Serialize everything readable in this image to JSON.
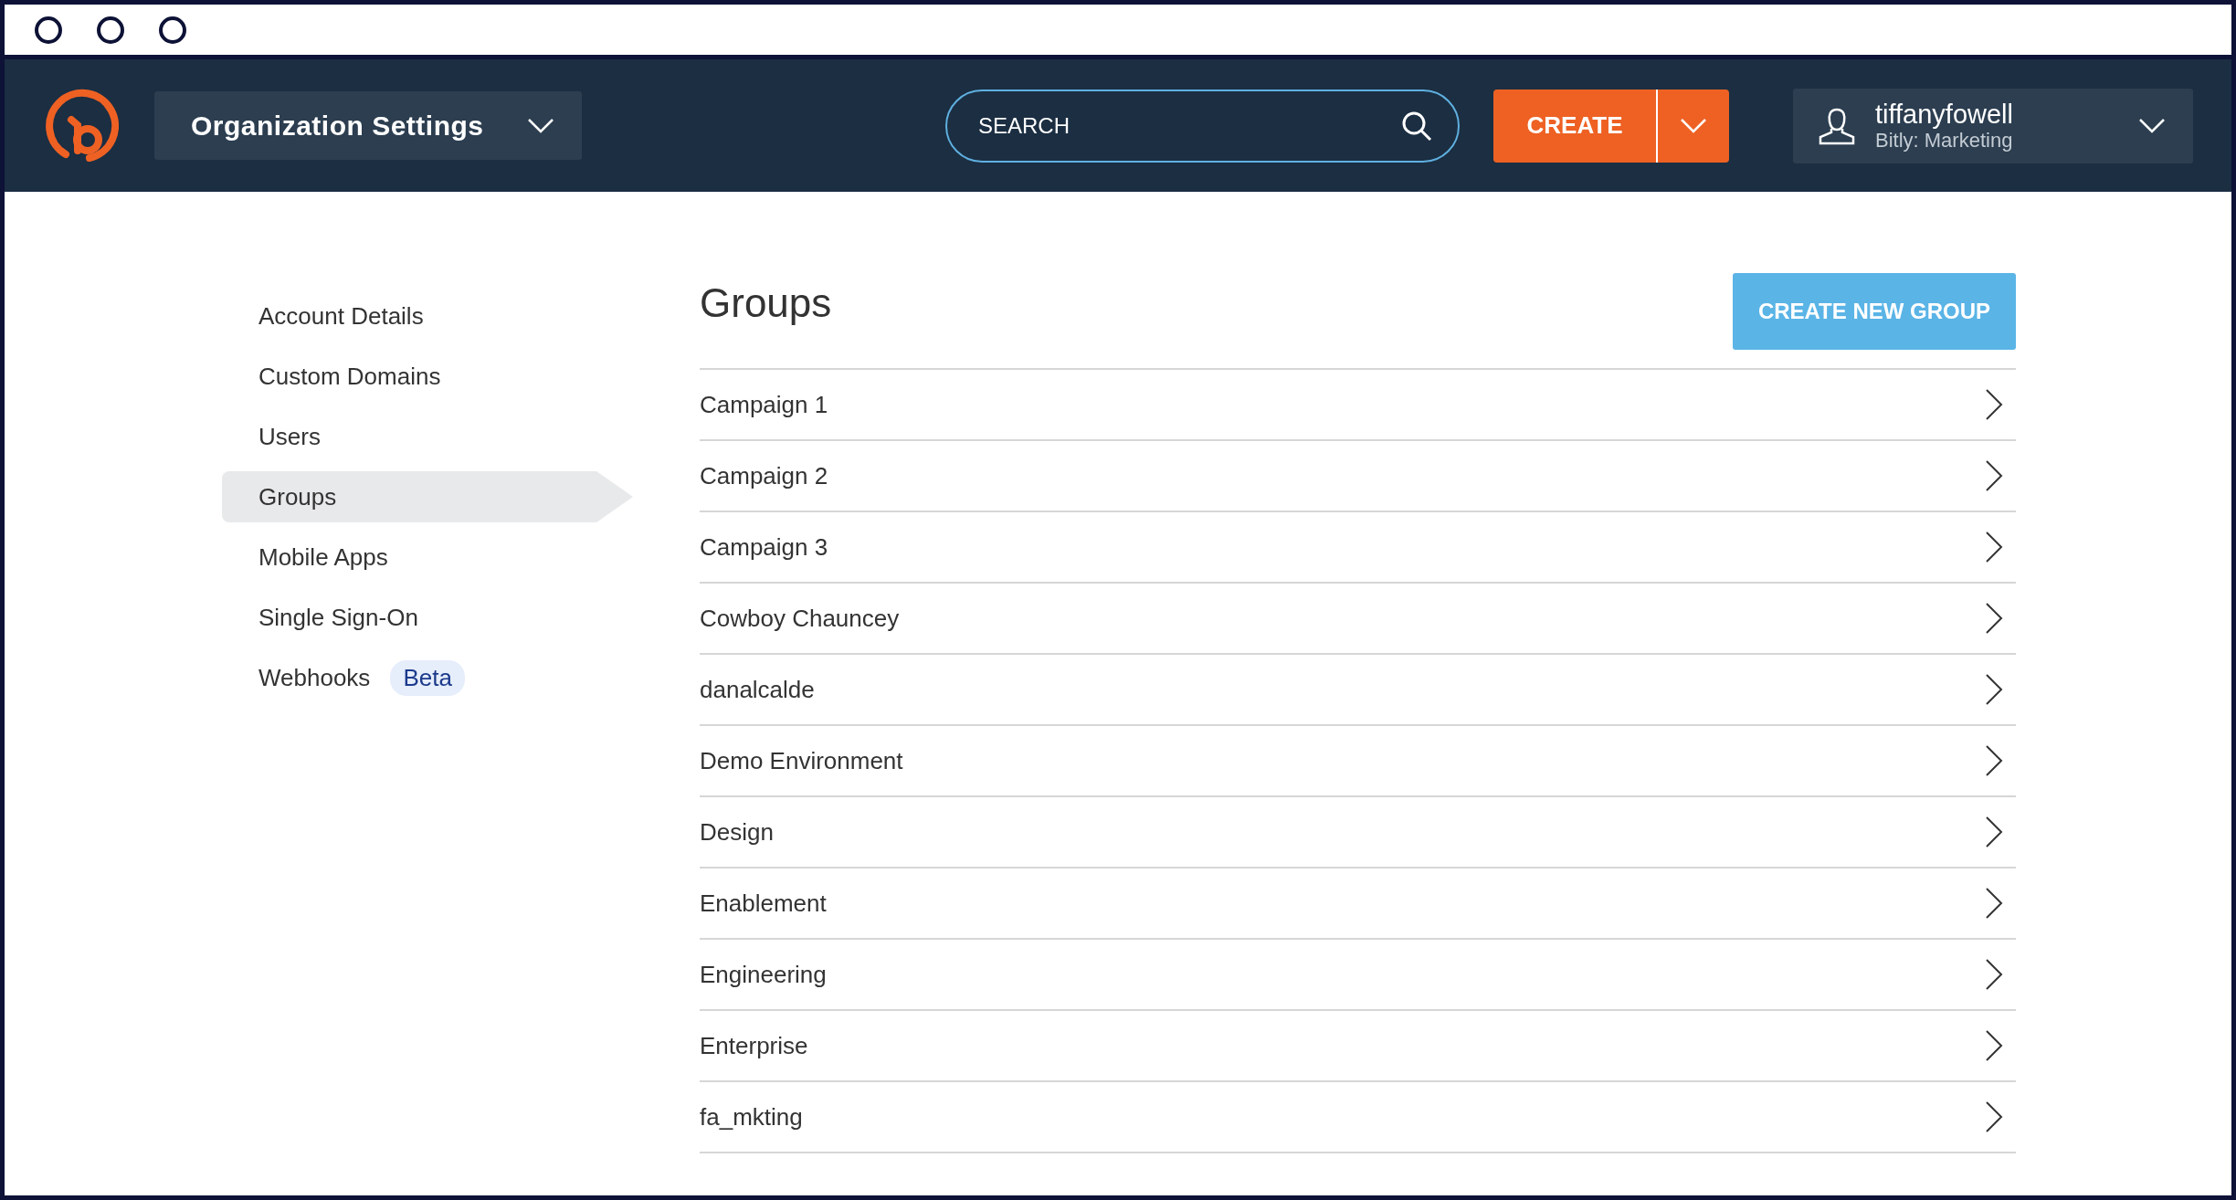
{
  "header": {
    "org_menu": {
      "label": "Organization Settings"
    },
    "search": {
      "placeholder": "SEARCH"
    },
    "create_button": {
      "label": "CREATE"
    },
    "user": {
      "name": "tiffanyfowell",
      "org": "Bitly: Marketing"
    }
  },
  "sidebar": {
    "items": [
      {
        "label": "Account Details",
        "selected": false
      },
      {
        "label": "Custom Domains",
        "selected": false
      },
      {
        "label": "Users",
        "selected": false
      },
      {
        "label": "Groups",
        "selected": true
      },
      {
        "label": "Mobile Apps",
        "selected": false
      },
      {
        "label": "Single Sign-On",
        "selected": false
      },
      {
        "label": "Webhooks",
        "selected": false,
        "badge": "Beta"
      }
    ]
  },
  "groups": {
    "title": "Groups",
    "create_button": "CREATE NEW GROUP",
    "rows": [
      "Campaign 1",
      "Campaign 2",
      "Campaign 3",
      "Cowboy Chauncey",
      "danalcalde",
      "Demo Environment",
      "Design",
      "Enablement",
      "Engineering",
      "Enterprise",
      "fa_mkting"
    ]
  }
}
